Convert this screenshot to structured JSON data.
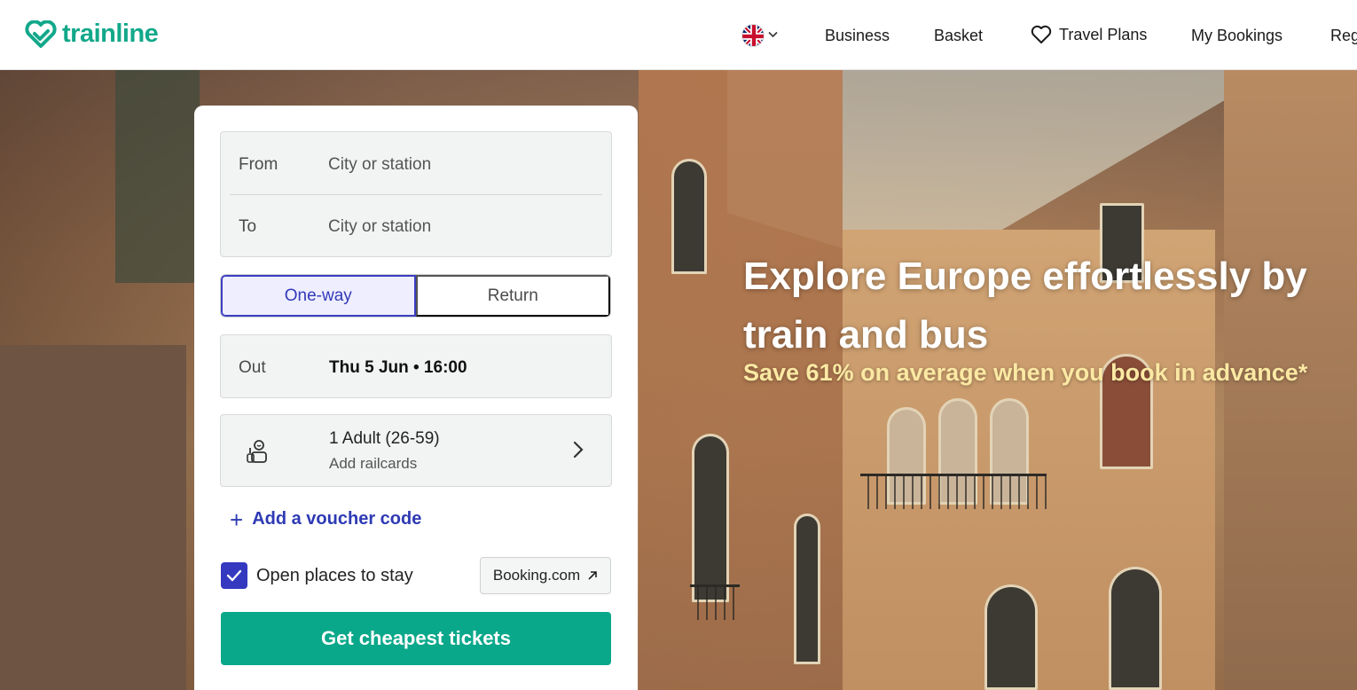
{
  "header": {
    "brand": "trainline",
    "language_flag": "uk-flag-icon",
    "nav": {
      "business": "Business",
      "basket": "Basket",
      "travel_plans": "Travel Plans",
      "my_bookings": "My Bookings",
      "register_partial": "Reg"
    }
  },
  "search": {
    "from_label": "From",
    "from_placeholder": "City or station",
    "to_label": "To",
    "to_placeholder": "City or station",
    "trip_types": {
      "one_way": "One-way",
      "return": "Return",
      "selected": "One-way"
    },
    "out_label": "Out",
    "out_value": "Thu 5 Jun • 16:00",
    "passengers": "1 Adult (26-59)",
    "railcards": "Add railcards",
    "voucher": "Add a voucher code",
    "stay_checkbox_label": "Open places to stay",
    "stay_checked": true,
    "booking_partner": "Booking.com",
    "submit": "Get cheapest tickets"
  },
  "hero": {
    "title": "Explore Europe effortlessly by train and bus",
    "subtitle": "Save 61% on average when you book in advance*"
  },
  "colors": {
    "brand": "#12a88a",
    "cta": "#0aa88a",
    "accent": "#3439c0",
    "subtitle": "#fbe9a3"
  }
}
